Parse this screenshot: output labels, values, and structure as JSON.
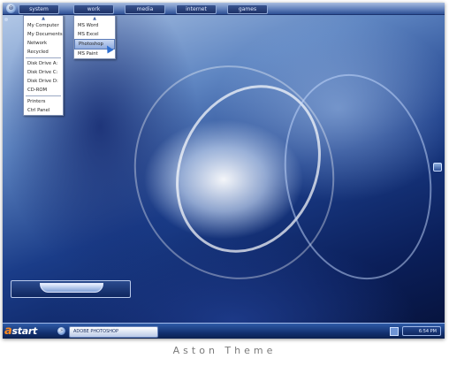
{
  "menubar": {
    "system_icon": "app-orb-icon",
    "tabs": [
      {
        "label": "system"
      },
      {
        "label": "work"
      },
      {
        "label": "media"
      },
      {
        "label": "internet"
      },
      {
        "label": "games"
      }
    ]
  },
  "system_menu": {
    "items": [
      "My Computer",
      "My Documents",
      "Network",
      "Recycled"
    ],
    "drives": [
      "Disk Drive A:",
      "Disk Drive C:",
      "Disk Drive D:",
      "CD-ROM"
    ],
    "tools": [
      "Printers",
      "Ctrl Panel"
    ]
  },
  "work_menu": {
    "items": [
      "MS Word",
      "MS Excel",
      "Photoshop",
      "MS Paint"
    ],
    "selected": "Photoshop"
  },
  "taskbar": {
    "start_label": "start",
    "start_letter": "a",
    "task_label": "ADOBE PHOTOSHOP",
    "clock": "6:54 PM"
  },
  "caption": "Aston Theme",
  "colors": {
    "accent": "#2c4f98",
    "taskbar": "#12306f",
    "start_a": "#ff8a1f"
  }
}
